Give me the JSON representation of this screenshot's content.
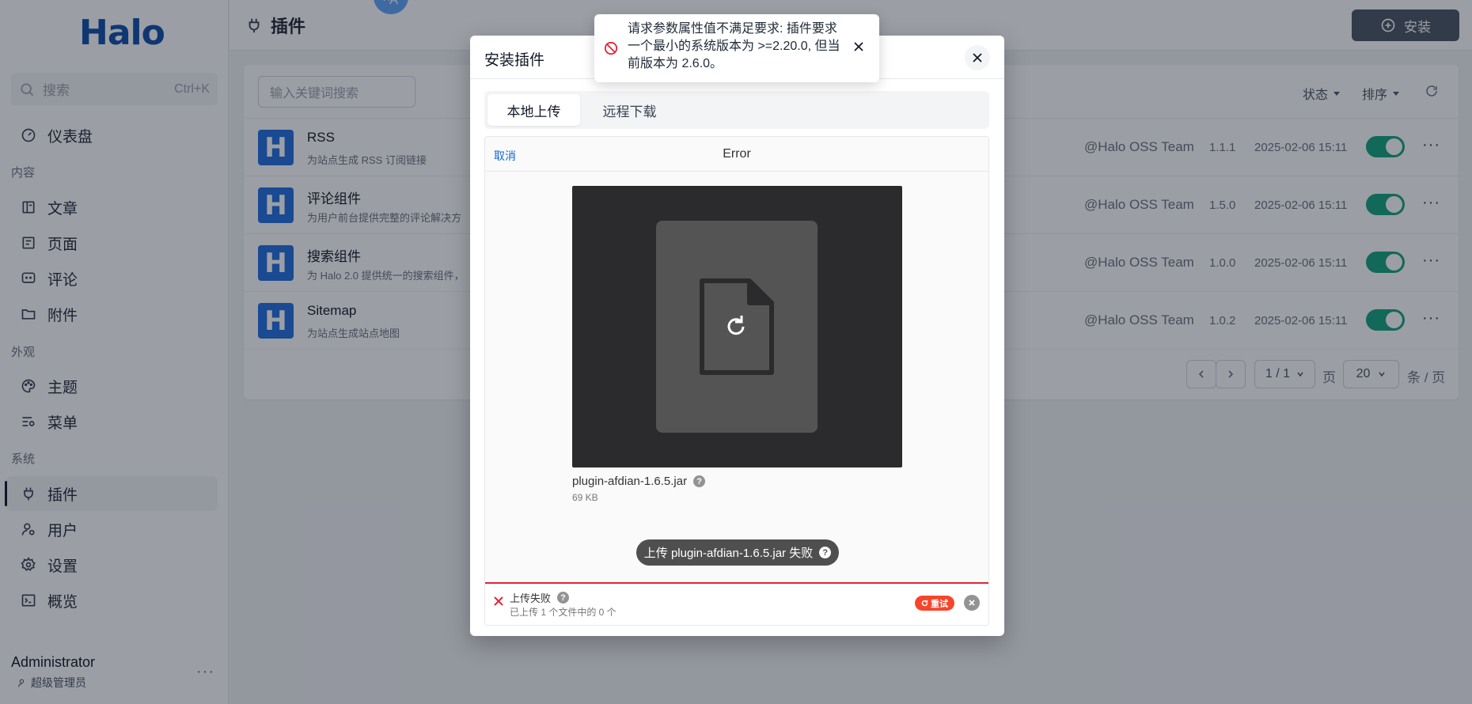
{
  "sidebar": {
    "logo": "Halo",
    "search": {
      "placeholder": "搜索",
      "shortcut": "Ctrl+K"
    },
    "items": [
      {
        "label": "仪表盘"
      },
      {
        "label": "文章"
      },
      {
        "label": "页面"
      },
      {
        "label": "评论"
      },
      {
        "label": "附件"
      },
      {
        "label": "主题"
      },
      {
        "label": "菜单"
      },
      {
        "label": "插件"
      },
      {
        "label": "用户"
      },
      {
        "label": "设置"
      },
      {
        "label": "概览"
      }
    ],
    "groups": {
      "content": "内容",
      "appearance": "外观",
      "system": "系统"
    },
    "user": {
      "name": "Administrator",
      "role": "超级管理员",
      "more": "···"
    }
  },
  "header": {
    "title": "插件",
    "install_label": "安装",
    "translate_glyph": "ᴬA"
  },
  "list": {
    "keyword_placeholder": "输入关键词搜索",
    "filter_status": "状态",
    "filter_sort": "排序",
    "plugins": [
      {
        "icon": "H",
        "name": "RSS",
        "desc": "为站点生成 RSS 订阅链接",
        "author": "@Halo OSS Team",
        "version": "1.1.1",
        "date": "2025-02-06 15:11",
        "enabled": true
      },
      {
        "icon": "H",
        "name": "评论组件",
        "desc": "为用户前台提供完整的评论解决方",
        "author": "@Halo OSS Team",
        "version": "1.5.0",
        "date": "2025-02-06 15:11",
        "enabled": true
      },
      {
        "icon": "H",
        "name": "搜索组件",
        "desc": "为 Halo 2.0 提供统一的搜索组件，",
        "author": "@Halo OSS Team",
        "version": "1.0.0",
        "date": "2025-02-06 15:11",
        "enabled": true
      },
      {
        "icon": "H",
        "name": "Sitemap",
        "desc": "为站点生成站点地图",
        "author": "@Halo OSS Team",
        "version": "1.0.2",
        "date": "2025-02-06 15:11",
        "enabled": true
      }
    ],
    "pagination": {
      "page": "1 / 1",
      "page_unit": "页",
      "size": "20",
      "size_unit": "条 / 页"
    }
  },
  "modal": {
    "title": "安装插件",
    "tabs": [
      {
        "label": "本地上传"
      },
      {
        "label": "远程下载"
      }
    ],
    "uploader": {
      "cancel_label": "取消",
      "header_status": "Error",
      "file_name": "plugin-afdian-1.6.5.jar",
      "file_size": "69 KB",
      "fail_message": "上传 plugin-afdian-1.6.5.jar 失败",
      "status_title": "上传失败",
      "status_sub": "已上传 1 个文件中的 0 个",
      "retry_label": "重试"
    }
  },
  "toast": {
    "message": "请求参数属性值不满足要求: 插件要求一个最小的系统版本为 >=2.20.0, 但当前版本为 2.6.0。"
  },
  "colors": {
    "brand": "#0e4ea9",
    "toggle_on": "#14a37f",
    "error": "#e32437",
    "retry": "#f7452b"
  }
}
